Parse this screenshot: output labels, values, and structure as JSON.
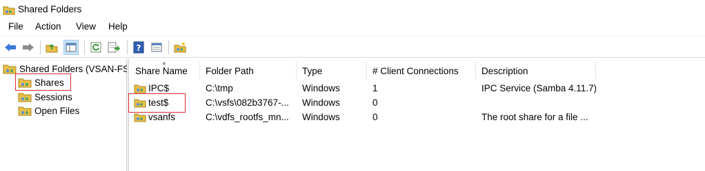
{
  "window": {
    "title": "Shared Folders"
  },
  "menu": {
    "items": [
      "File",
      "Action",
      "View",
      "Help"
    ]
  },
  "toolbar": {
    "buttons": [
      "back-icon",
      "forward-icon",
      "up-folder-icon",
      "show-hide-tree-icon",
      "refresh-icon",
      "export-list-icon",
      "help-icon",
      "properties-icon",
      "new-share-icon"
    ]
  },
  "tree": {
    "root": "Shared Folders (VSAN-FS",
    "children": [
      "Shares",
      "Sessions",
      "Open Files"
    ],
    "selected": "Shares"
  },
  "table": {
    "columns": [
      "Share Name",
      "Folder Path",
      "Type",
      "# Client Connections",
      "Description"
    ],
    "sorted_column": "Share Name",
    "rows": [
      {
        "name": "IPC$",
        "path": "C:\\tmp",
        "type": "Windows",
        "connections": "1",
        "description": "IPC Service (Samba 4.11.7)"
      },
      {
        "name": "test$",
        "path": "C:\\vsfs\\082b3767-...",
        "type": "Windows",
        "connections": "0",
        "description": ""
      },
      {
        "name": "vsanfs",
        "path": "C:\\vdfs_rootfs_mn...",
        "type": "Windows",
        "connections": "0",
        "description": "The root share for a file ..."
      }
    ],
    "highlighted_row": "test$"
  },
  "colors": {
    "highlight": "#d9262c",
    "toolbar_pressed": "#cce4f7"
  }
}
